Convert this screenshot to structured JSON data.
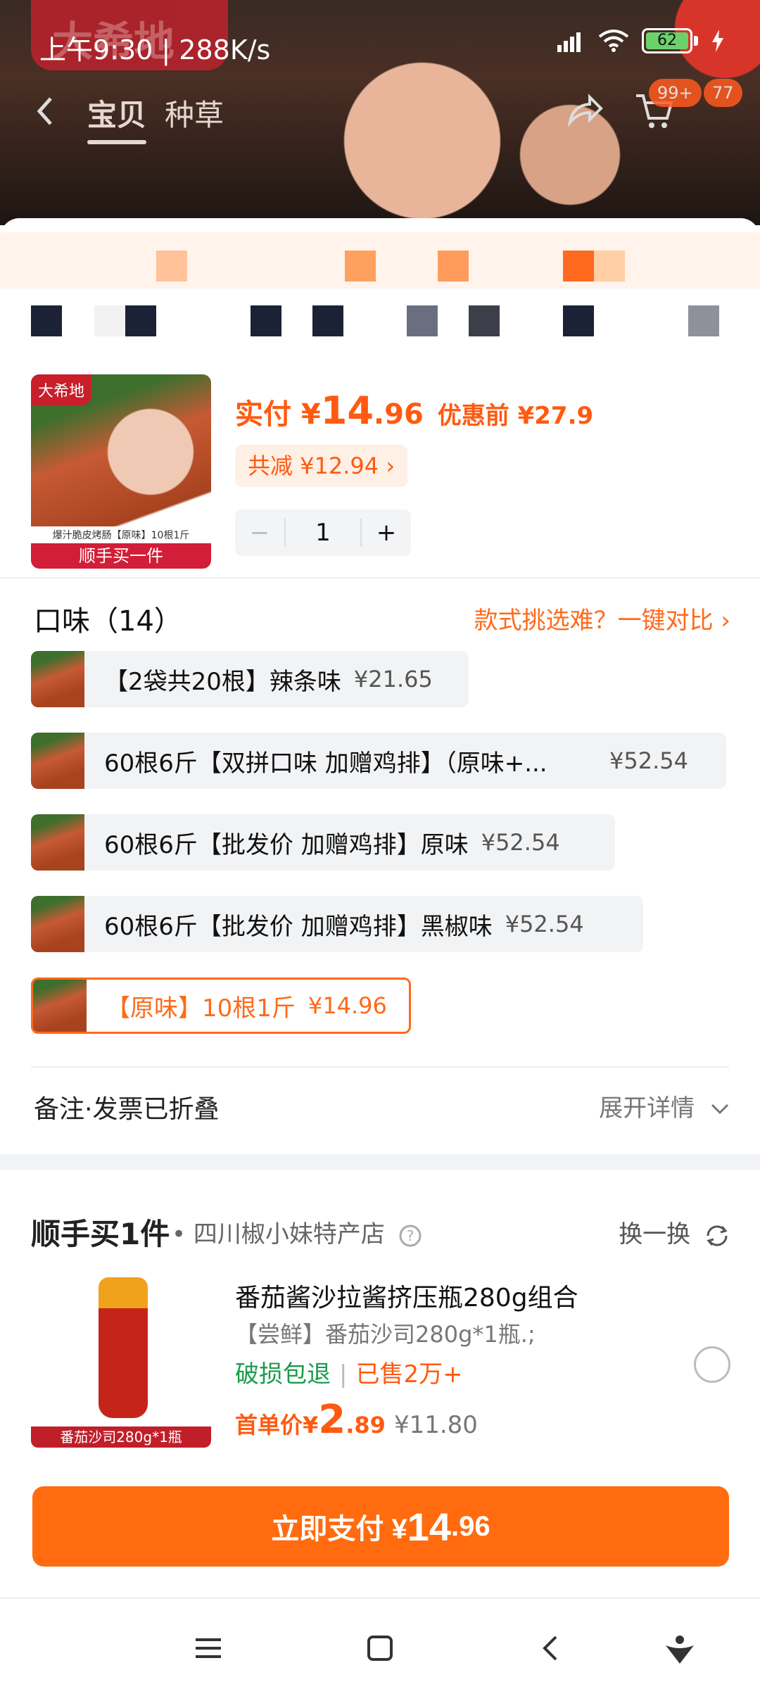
{
  "status_bar": {
    "time": "上午9:30 | 288K/s",
    "battery": "62"
  },
  "nav": {
    "tab_product": "宝贝",
    "tab_recommend": "种草",
    "cart_badge": "99+",
    "msg_badge": "77"
  },
  "product": {
    "thumb_logo": "大希地",
    "thumb_caption": "爆汁脆皮烤肠【原味】10根1斤",
    "thumb_tag": "顺手买一件",
    "paid_label": "实付 ¥",
    "paid_int": "14",
    "paid_dec": ".96",
    "original": "优惠前 ¥27.9",
    "discount": "共减 ¥12.94 ›",
    "minus": "−",
    "quantity": "1",
    "plus": "+"
  },
  "flavor": {
    "title": "口味（14）",
    "compare": "款式挑选难？一键对比 ›",
    "options": [
      {
        "label": "【2袋共20根】辣条味",
        "price": "¥21.65"
      },
      {
        "label": "60根6斤【双拼口味 加赠鸡排】（原味+...",
        "price": "¥52.54"
      },
      {
        "label": "60根6斤【批发价 加赠鸡排】原味",
        "price": "¥52.54"
      },
      {
        "label": "60根6斤【批发价 加赠鸡排】黑椒味",
        "price": "¥52.54"
      },
      {
        "label": "【原味】10根1斤",
        "price": "¥14.96"
      }
    ]
  },
  "remark": {
    "label": "备注·发票已折叠",
    "expand": "展开详情"
  },
  "buy_one_more": {
    "title": "顺手买1件",
    "store": "• 四川椒小妹特产店",
    "swap": "换一换",
    "name": "番茄酱沙拉酱挤压瓶280g组合",
    "spec": "【尝鲜】番茄沙司280g*1瓶.;",
    "tag_return": "破损包退",
    "tag_sold": "已售2万+",
    "img_tag": "番茄沙司280g*1瓶",
    "price_label": "首单价¥",
    "price_int": "2",
    "price_dec": ".89",
    "old_price": "¥11.80"
  },
  "pay": {
    "label": "立即支付 ¥",
    "int": "14",
    "dec": ".96"
  },
  "colors": {
    "accent": "#ff6b0e",
    "price": "#ff5a10",
    "green": "#1a9c4c"
  }
}
